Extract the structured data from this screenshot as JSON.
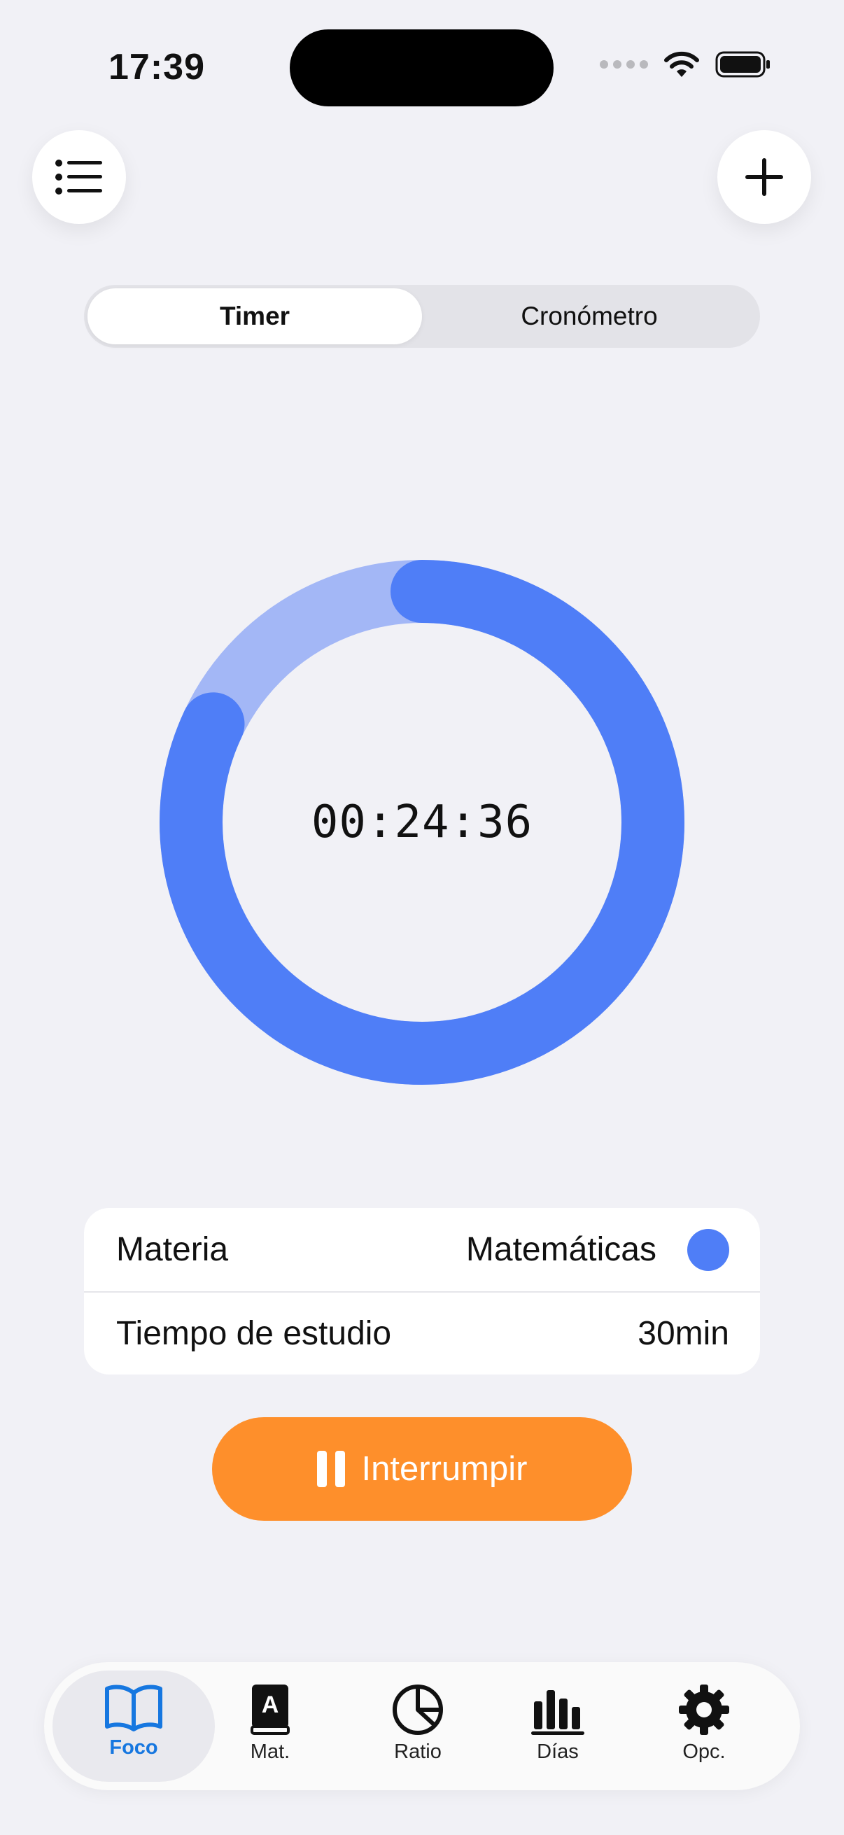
{
  "status_bar": {
    "time": "17:39"
  },
  "segmented": {
    "timer_label": "Timer",
    "chronometer_label": "Cronómetro"
  },
  "timer": {
    "display": "00:24:36",
    "progress_fraction": 0.82
  },
  "info": {
    "subject_label": "Materia",
    "subject_value": "Matemáticas",
    "subject_color": "#4f7ef7",
    "study_time_label": "Tiempo de estudio",
    "study_time_value": "30min"
  },
  "pause_button": {
    "label": "Interrumpir"
  },
  "tabbar": {
    "items": [
      {
        "label": "Foco",
        "icon": "book-icon",
        "active": true
      },
      {
        "label": "Mat.",
        "icon": "dictionary-icon",
        "active": false
      },
      {
        "label": "Ratio",
        "icon": "pie-chart-icon",
        "active": false
      },
      {
        "label": "Días",
        "icon": "bar-chart-icon",
        "active": false
      },
      {
        "label": "Opc.",
        "icon": "gear-icon",
        "active": false
      }
    ]
  },
  "colors": {
    "accent": "#4f7ef7",
    "accent_light": "#a3b7f6",
    "button": "#fe8f2b",
    "tab_active": "#1677e0"
  }
}
